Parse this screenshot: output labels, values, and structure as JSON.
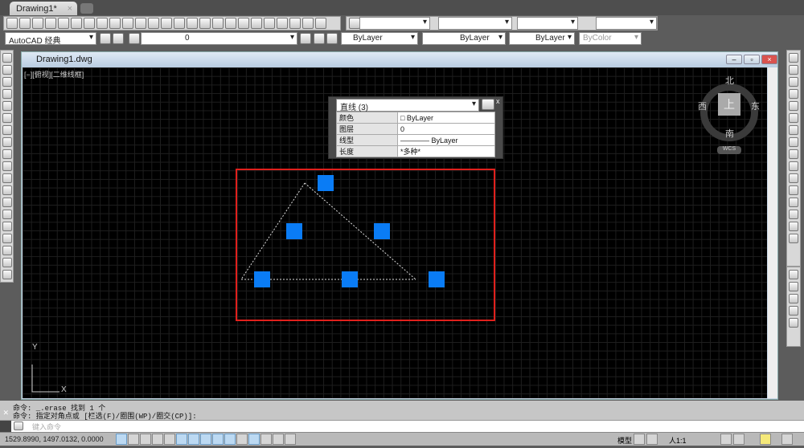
{
  "tabs": {
    "active": "Drawing1*",
    "close": "×"
  },
  "toolbar": {
    "workspace": "AutoCAD 经典",
    "layer": "0",
    "color": "ByLayer",
    "linetype": "ByLayer",
    "lineweight": "ByLayer",
    "plotstyle": "ByColor"
  },
  "window": {
    "title": "Drawing1.dwg",
    "viewport_label": "[−][俯视][二维线框]",
    "minimize": "–",
    "restore": "▫",
    "close": "×"
  },
  "viewcube": {
    "north": "北",
    "south": "南",
    "east": "东",
    "west": "西",
    "top": "上",
    "wcs": "WCS"
  },
  "ucs": {
    "x": "X",
    "y": "Y"
  },
  "properties": {
    "selection": "直线 (3)",
    "rows": [
      {
        "label": "颜色",
        "value": "□ ByLayer"
      },
      {
        "label": "图层",
        "value": "0"
      },
      {
        "label": "线型",
        "value": "———— ByLayer"
      },
      {
        "label": "长度",
        "value": "*多种*"
      }
    ],
    "close": "x"
  },
  "command": {
    "history": [
      "命令:  _.erase 找到 1 个",
      "命令:  指定对角点或 [栏选(F)/圈围(WP)/圈交(CP)]:"
    ],
    "placeholder": "键入命令",
    "close": "✕"
  },
  "status": {
    "coords": "1529.8990, 1497.0132, 0.0000",
    "model": "模型",
    "scale": "人1:1"
  },
  "colors": {
    "grip": "#0a7cf5",
    "selection_box": "#e0201c"
  }
}
